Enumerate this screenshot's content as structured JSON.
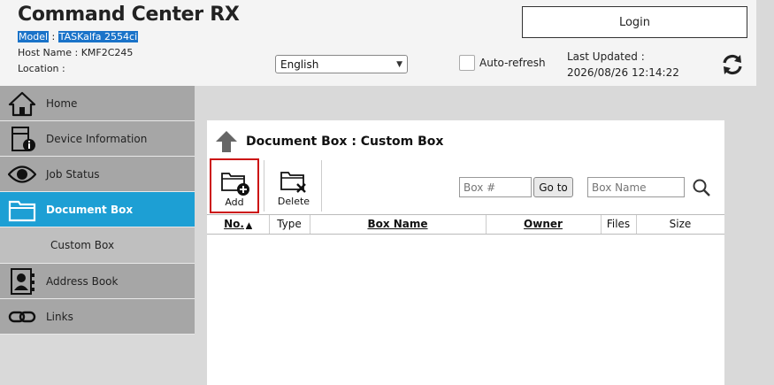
{
  "header": {
    "title": "Command Center RX",
    "model_label": "Model",
    "model_value": "TASKalfa 2554ci",
    "host_label": "Host Name : KMF2C245",
    "location_label": "Location :",
    "language": "English",
    "auto_refresh_label": "Auto-refresh",
    "login_label": "Login",
    "last_updated_label": "Last Updated :",
    "last_updated_value": "2026/08/26 12:14:22"
  },
  "sidebar": {
    "items": [
      {
        "label": "Home",
        "icon": "home-icon"
      },
      {
        "label": "Device Information",
        "icon": "device-info-icon"
      },
      {
        "label": "Job Status",
        "icon": "eye-icon"
      },
      {
        "label": "Document Box",
        "icon": "folder-icon"
      },
      {
        "label": "Address Book",
        "icon": "address-book-icon"
      },
      {
        "label": "Links",
        "icon": "link-icon"
      }
    ],
    "sub_item": "Custom Box",
    "active_color": "#1d9fd4"
  },
  "main": {
    "title": "Document Box : Custom Box",
    "add_label": "Add",
    "delete_label": "Delete",
    "box_num_placeholder": "Box #",
    "goto_label": "Go to",
    "box_name_placeholder": "Box Name",
    "columns": [
      "No.",
      "Type",
      "Box Name",
      "Owner",
      "Files",
      "Size"
    ],
    "sort_indicator": "▲"
  }
}
